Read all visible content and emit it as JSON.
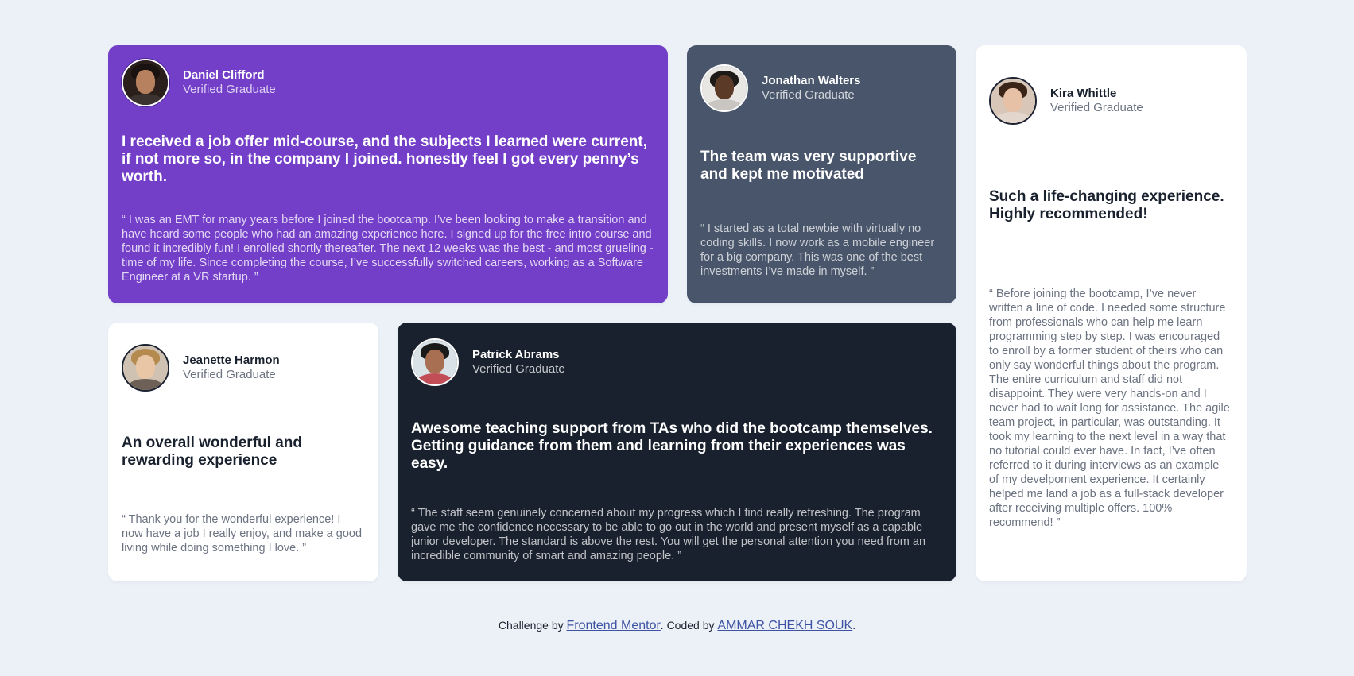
{
  "colors": {
    "background": "#ecf1f8",
    "purple": "#733fc8",
    "slate": "#48556a",
    "white": "#ffffff",
    "dark": "#19212e",
    "link": "#3e52a3"
  },
  "testimonials": [
    {
      "name": "Daniel Clifford",
      "role": "Verified Graduate",
      "avatar": "daniel-avatar",
      "headline": "I received a job offer mid-course, and the subjects I learned were current, if not more so, in the company I joined. honestly feel I got every penny’s worth.",
      "quote": "“ I was an EMT for many years before I joined the bootcamp. I’ve been looking to make a transition and have heard some people who had an amazing experience here. I signed up for the free intro course and found it incredibly fun! I enrolled shortly thereafter. The next 12 weeks was the best - and most grueling - time of my life. Since completing the course, I’ve successfully switched careers, working as a Software Engineer at a VR startup. ”"
    },
    {
      "name": "Jonathan Walters",
      "role": "Verified Graduate",
      "avatar": "jonathan-avatar",
      "headline": "The team was very supportive and kept me motivated",
      "quote": "“ I started as a total newbie with virtually no coding skills. I now work as a mobile engineer for a big company. This was one of the best investments I’ve made in myself. ”"
    },
    {
      "name": "Kira Whittle",
      "role": "Verified Graduate",
      "avatar": "kira-avatar",
      "headline": "Such a life-changing experience. Highly recommended!",
      "quote": "“ Before joining the bootcamp, I’ve never written a line of code. I needed some structure from professionals who can help me learn programming step by step. I was encouraged to enroll by a former student of theirs who can only say wonderful things about the program. The entire curriculum and staff did not disappoint. They were very hands-on and I never had to wait long for assistance. The agile team project, in particular, was outstanding. It took my learning to the next level in a way that no tutorial could ever have. In fact, I’ve often referred to it during interviews as an example of my develpoment experience. It certainly helped me land a job as a full-stack developer after receiving multiple offers. 100% recommend! ”"
    },
    {
      "name": "Jeanette Harmon",
      "role": "Verified Graduate",
      "avatar": "jeanette-avatar",
      "headline": "An overall wonderful and rewarding experience",
      "quote": "“ Thank you for the wonderful experience! I now have a job I really enjoy, and make a good living while doing something I love. ”"
    },
    {
      "name": "Patrick Abrams",
      "role": "Verified Graduate",
      "avatar": "patrick-avatar",
      "headline": "Awesome teaching support from TAs who did the bootcamp themselves. Getting guidance from them and learning from their experiences was easy.",
      "quote": "“ The staff seem genuinely concerned about my progress which I find really refreshing. The program gave me the confidence necessary to be able to go out in the world and present myself as a capable junior developer. The standard is above the rest. You will get the personal attention you need from an incredible community of smart and amazing people. ”"
    }
  ],
  "footer": {
    "prefix": "Challenge by ",
    "challenge_link": "Frontend Mentor",
    "middle": ". Coded by ",
    "author_link": "AMMAR CHEKH SOUK",
    "suffix": "."
  }
}
